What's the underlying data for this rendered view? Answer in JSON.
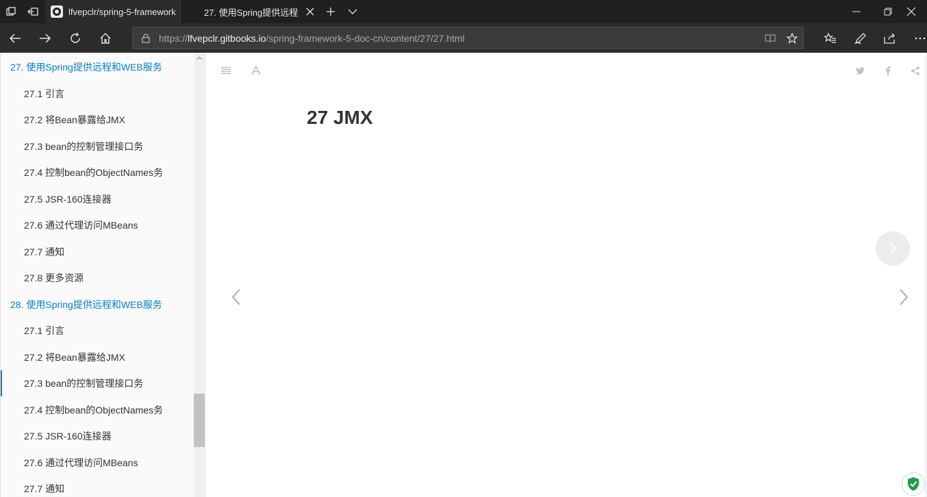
{
  "browser": {
    "tabs": [
      {
        "title": "lfvepclr/spring-5-framework",
        "active": false
      },
      {
        "title": "27. 使用Spring提供远程",
        "active": true
      }
    ],
    "address": {
      "scheme": "https://",
      "host": "lfvepclr.gitbooks.io",
      "path": "/spring-framework-5-doc-cn/content/27/27.html"
    },
    "colors": {
      "chrome_dark": "#202020",
      "toolbar": "#2b2b2b",
      "address_bg": "#3b3b3b"
    }
  },
  "sidebar": {
    "items": [
      {
        "label": "27. 使用Spring提供远程和WEB服务",
        "type": "chapter"
      },
      {
        "label": "27.1 引言",
        "type": "sub"
      },
      {
        "label": "27.2 将Bean暴露给JMX",
        "type": "sub"
      },
      {
        "label": "27.3 bean的控制管理接口务",
        "type": "sub"
      },
      {
        "label": "27.4 控制bean的ObjectNames务",
        "type": "sub"
      },
      {
        "label": "27.5 JSR-160连接器",
        "type": "sub"
      },
      {
        "label": "27.6 通过代理访问MBeans",
        "type": "sub"
      },
      {
        "label": "27.7 通知",
        "type": "sub"
      },
      {
        "label": "27.8 更多资源",
        "type": "sub"
      },
      {
        "label": "28. 使用Spring提供远程和WEB服务",
        "type": "chapter"
      },
      {
        "label": "27.1 引言",
        "type": "sub"
      },
      {
        "label": "27.2 将Bean暴露给JMX",
        "type": "sub"
      },
      {
        "label": "27.3 bean的控制管理接口务",
        "type": "sub",
        "current": true
      },
      {
        "label": "27.4 控制bean的ObjectNames务",
        "type": "sub"
      },
      {
        "label": "27.5 JSR-160连接器",
        "type": "sub"
      },
      {
        "label": "27.6 通过代理访问MBeans",
        "type": "sub"
      },
      {
        "label": "27.7 通知",
        "type": "sub"
      }
    ],
    "colors": {
      "chapter_link": "#0d7ec2",
      "text": "#333333"
    }
  },
  "main": {
    "title": "27 JMX",
    "toolbar_icons": [
      "menu-icon",
      "font-settings-icon"
    ],
    "share_icons": [
      "twitter-icon",
      "facebook-icon",
      "share-icon"
    ]
  }
}
